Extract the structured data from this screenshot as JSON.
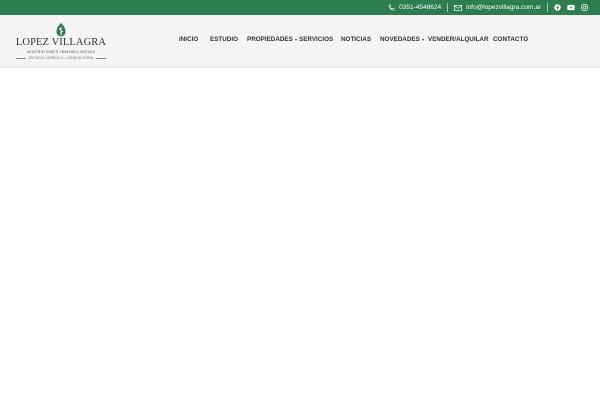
{
  "topbar": {
    "phone": "0351-4548624",
    "email": "info@lopezvillagra.com.ar",
    "social": [
      "facebook-icon",
      "youtube-icon",
      "instagram-icon"
    ],
    "bg_color": "#2e7d4f"
  },
  "logo": {
    "brand": "LOPEZ VILLAGRA",
    "subtitle": "INVERSIONES INMOBILIARIAS",
    "tagline": "ESTUDIO JURÍDICO • CONSULTORÍA",
    "leaf_color": "#2e7d4f"
  },
  "nav": {
    "items": [
      {
        "label": "INICIO"
      },
      {
        "label": "ESTUDIO"
      },
      {
        "label": "PROPIEDADES",
        "dropdown": true
      },
      {
        "label": "SERVICIOS"
      },
      {
        "label": "NOTICIAS"
      },
      {
        "label": "NOVEDADES",
        "dropdown": true
      },
      {
        "label": "VENDER/ALQUILAR"
      },
      {
        "label": "CONTACTO"
      }
    ]
  }
}
